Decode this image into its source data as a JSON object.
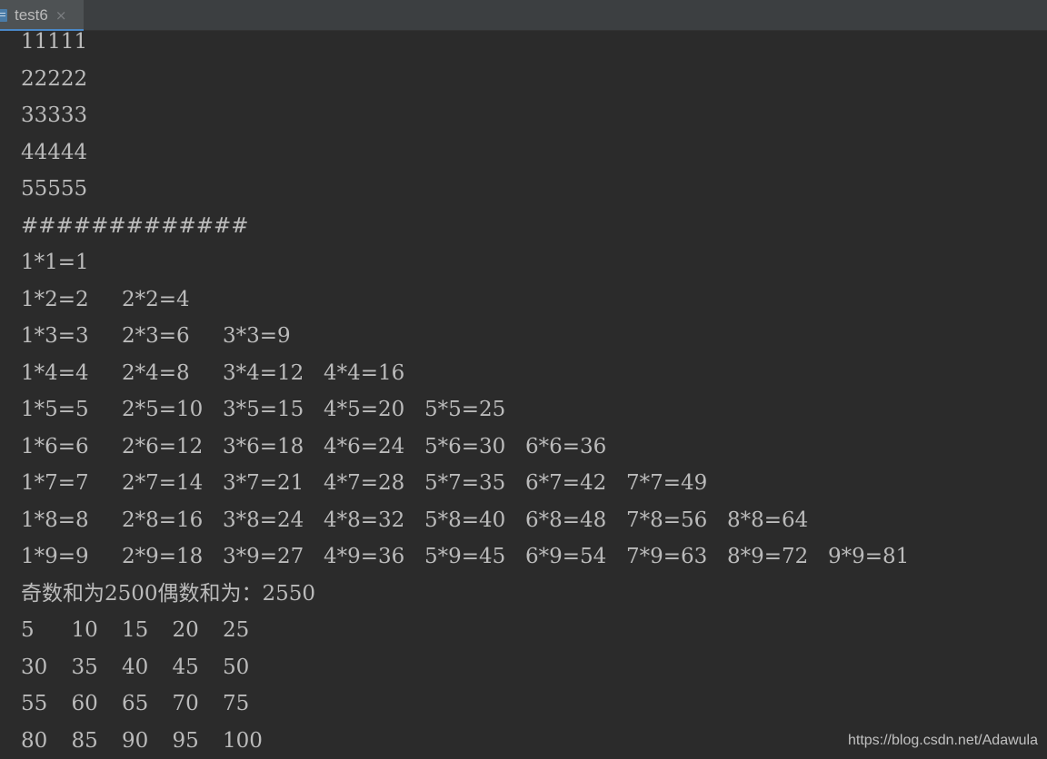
{
  "tab": {
    "label": "test6",
    "close_glyph": "×",
    "icon": "java-file-icon"
  },
  "console": {
    "lines": [
      [
        "11111"
      ],
      [
        "22222"
      ],
      [
        "33333"
      ],
      [
        "44444"
      ],
      [
        "55555"
      ],
      [
        "#############"
      ],
      [
        "1*1=1"
      ],
      [
        "1*2=2",
        "2*2=4"
      ],
      [
        "1*3=3",
        "2*3=6",
        "3*3=9"
      ],
      [
        "1*4=4",
        "2*4=8",
        "3*4=12",
        "4*4=16"
      ],
      [
        "1*5=5",
        "2*5=10",
        "3*5=15",
        "4*5=20",
        "5*5=25"
      ],
      [
        "1*6=6",
        "2*6=12",
        "3*6=18",
        "4*6=24",
        "5*6=30",
        "6*6=36"
      ],
      [
        "1*7=7",
        "2*7=14",
        "3*7=21",
        "4*7=28",
        "5*7=35",
        "6*7=42",
        "7*7=49"
      ],
      [
        "1*8=8",
        "2*8=16",
        "3*8=24",
        "4*8=32",
        "5*8=40",
        "6*8=48",
        "7*8=56",
        "8*8=64"
      ],
      [
        "1*9=9",
        "2*9=18",
        "3*9=27",
        "4*9=36",
        "5*9=45",
        "6*9=54",
        "7*9=63",
        "8*9=72",
        "9*9=81"
      ],
      [
        "奇数和为2500偶数和为：2550"
      ],
      [
        "5",
        "10",
        "15",
        "20",
        "25"
      ],
      [
        "30",
        "35",
        "40",
        "45",
        "50"
      ],
      [
        "55",
        "60",
        "65",
        "70",
        "75"
      ],
      [
        "80",
        "85",
        "90",
        "95",
        "100"
      ]
    ]
  },
  "watermark": "https://blog.csdn.net/Adawula",
  "colors": {
    "background": "#2b2b2b",
    "text": "#bbbbbb",
    "tabbar": "#3c3f41",
    "tab_active": "#4e5254",
    "accent": "#4a88c7"
  }
}
